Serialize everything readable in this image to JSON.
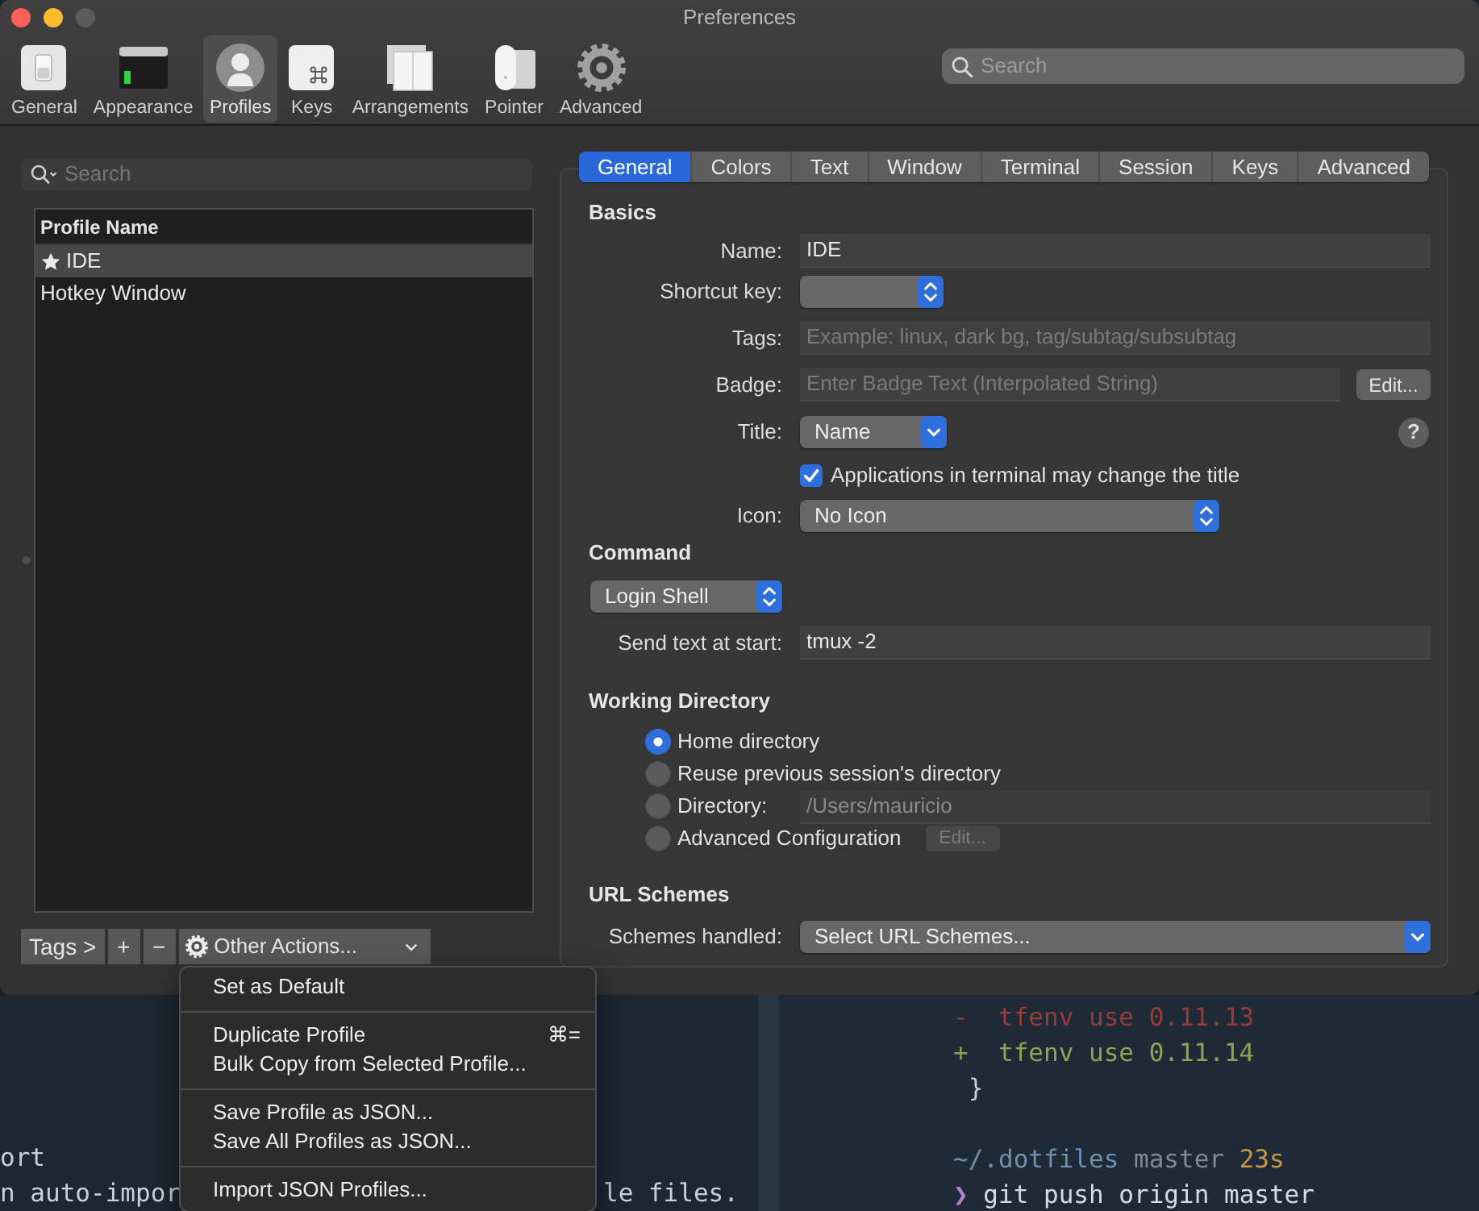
{
  "window": {
    "title": "Preferences"
  },
  "toolbar": {
    "items": [
      {
        "label": "General",
        "kind": "general",
        "selected": false
      },
      {
        "label": "Appearance",
        "kind": "appearance",
        "selected": false
      },
      {
        "label": "Profiles",
        "kind": "profiles",
        "selected": true
      },
      {
        "label": "Keys",
        "kind": "keys",
        "selected": false
      },
      {
        "label": "Arrangements",
        "kind": "arrangements",
        "selected": false
      },
      {
        "label": "Pointer",
        "kind": "pointer",
        "selected": false
      },
      {
        "label": "Advanced",
        "kind": "advanced",
        "selected": false
      }
    ],
    "search": {
      "placeholder": "Search"
    }
  },
  "profiles": {
    "search": {
      "placeholder": "Search"
    },
    "list": {
      "column": "Profile Name",
      "rows": [
        {
          "name": "IDE",
          "default": true,
          "selected": true
        },
        {
          "name": "Hotkey Window",
          "default": false,
          "selected": false
        }
      ]
    },
    "buttons": [
      {
        "label": "Tags >",
        "kind": "text"
      },
      {
        "label": "+",
        "kind": "text"
      },
      {
        "label": "−",
        "kind": "text"
      },
      {
        "label": "Other Actions...",
        "kind": "actions"
      }
    ]
  },
  "settings": {
    "tabs": [
      {
        "label": "General",
        "selected": true
      },
      {
        "label": "Colors",
        "selected": false
      },
      {
        "label": "Text",
        "selected": false
      },
      {
        "label": "Window",
        "selected": false
      },
      {
        "label": "Terminal",
        "selected": false
      },
      {
        "label": "Session",
        "selected": false
      },
      {
        "label": "Keys",
        "selected": false
      },
      {
        "label": "Advanced",
        "selected": false
      }
    ],
    "basics": {
      "heading": "Basics",
      "name": {
        "label": "Name:",
        "value": "IDE"
      },
      "shortcut_key": {
        "label": "Shortcut key:"
      },
      "tags": {
        "label": "Tags:",
        "placeholder": "Example: linux, dark bg, tag/subtag/subsubtag"
      },
      "badge": {
        "label": "Badge:",
        "placeholder": "Enter Badge Text (Interpolated String)",
        "button": "Edit..."
      },
      "title": {
        "label": "Title:",
        "value": "Name",
        "help": "?"
      },
      "title_changes": {
        "label": "Applications in terminal may change the title",
        "checked": true
      },
      "icon": {
        "label": "Icon:",
        "value": "No Icon"
      }
    },
    "command": {
      "heading": "Command",
      "mode": {
        "value": "Login Shell"
      },
      "send_text": {
        "label": "Send text at start:",
        "value": "tmux -2"
      }
    },
    "working_directory": {
      "heading": "Working Directory",
      "options": [
        {
          "kind": "plain",
          "label": "Home directory",
          "selected": true
        },
        {
          "kind": "plain",
          "label": "Reuse previous session's directory",
          "selected": false
        },
        {
          "kind": "path",
          "label": "Directory:",
          "selected": false,
          "value": "/Users/mauricio",
          "disabled": true
        },
        {
          "kind": "edit",
          "label": "Advanced Configuration",
          "selected": false,
          "button": "Edit...",
          "disabled": true
        }
      ]
    },
    "url_schemes": {
      "heading": "URL Schemes",
      "schemes": {
        "label": "Schemes handled:",
        "value": "Select URL Schemes..."
      }
    }
  },
  "menu": {
    "items": [
      {
        "kind": "item",
        "label": "Set as Default"
      },
      {
        "kind": "separator"
      },
      {
        "kind": "item",
        "label": "Duplicate Profile",
        "shortcut": "⌘="
      },
      {
        "kind": "item",
        "label": "Bulk Copy from Selected Profile..."
      },
      {
        "kind": "separator"
      },
      {
        "kind": "item",
        "label": "Save Profile as JSON..."
      },
      {
        "kind": "item",
        "label": "Save All Profiles as JSON..."
      },
      {
        "kind": "separator"
      },
      {
        "kind": "item",
        "label": "Import JSON Profiles..."
      }
    ]
  },
  "terminal": {
    "left_pane": {
      "lines": [
        {
          "segments": [
            {
              "text": "ort"
            }
          ]
        },
        {
          "segments": [
            {
              "text": "n auto-impor"
            },
            {
              "text": "le files."
            }
          ]
        }
      ]
    },
    "right_pane": {
      "blocks": [
        {
          "lines": [
            {
              "segments": [
                {
                  "text": "-  tfenv use 0.11.13",
                  "color": "#9a3a3a"
                }
              ]
            },
            {
              "segments": [
                {
                  "text": "+  tfenv use 0.11.14",
                  "color": "#93a055"
                }
              ]
            },
            {
              "segments": [
                {
                  "text": " }",
                  "color": "#c8d0d8"
                }
              ]
            }
          ]
        },
        {
          "lines": [
            {
              "segments": [
                {
                  "text": "~/.dotfiles",
                  "color": "#6f8fae"
                },
                {
                  "text": " master",
                  "color": "#7d8a95"
                },
                {
                  "text": " 23s",
                  "color": "#c39a45"
                }
              ]
            },
            {
              "segments": [
                {
                  "text": "❯",
                  "color": "#b77fcf"
                },
                {
                  "text": " git push origin master",
                  "color": "#d6dbe0"
                }
              ]
            }
          ]
        }
      ]
    }
  }
}
